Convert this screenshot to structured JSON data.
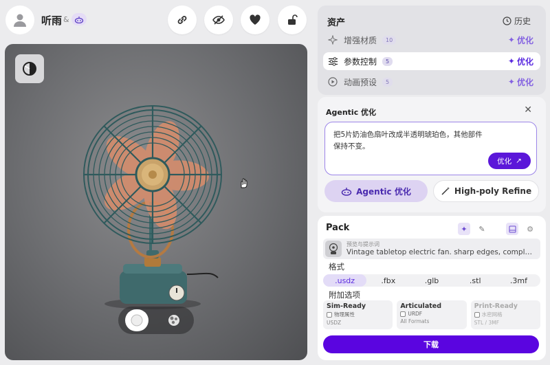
{
  "header": {
    "username": "听雨",
    "ampersand": "&",
    "agent_badge_icon": "agent-icon",
    "actions": [
      "link-icon",
      "eye-slash-icon",
      "heart-icon",
      "unlock-icon"
    ]
  },
  "viewport": {
    "toggle_icon": "half-circle-icon",
    "modes": [
      "solid-icon",
      "texture-icon"
    ],
    "cursor_icon": "hand-cursor-icon",
    "background_color": "#6d6e71"
  },
  "assets": {
    "title": "资产",
    "history_label": "历史",
    "rows": [
      {
        "label": "增强材质",
        "count": "10",
        "action": "优化",
        "icon": "sparkle-icon"
      },
      {
        "label": "参数控制",
        "count": "5",
        "action": "优化",
        "icon": "sliders-icon"
      },
      {
        "label": "动画预设",
        "count": "5",
        "action": "优化",
        "icon": "play-circle-icon"
      }
    ]
  },
  "agentic": {
    "title": "Agentic 优化",
    "prompt": "把5片奶油色扇叶改成半透明琥珀色，其他部件保持不变。",
    "submit_label": "优化",
    "tabs": [
      {
        "label": "Agentic 优化",
        "icon": "agent-icon"
      },
      {
        "label": "High-poly Refine",
        "icon": "magic-wand-icon"
      }
    ]
  },
  "pack": {
    "title": "Pack",
    "prompt_label": "预览与提示词",
    "prompt_text": "Vintage tabletop electric fan. sharp edges, complex...",
    "format_label": "格式",
    "formats": [
      ".usdz",
      ".fbx",
      ".glb",
      ".stl",
      ".3mf"
    ],
    "selected_format": ".usdz",
    "extras_label": "附加选项",
    "options": [
      {
        "title": "Sim-Ready",
        "check": "物理属性",
        "sub": "USDZ"
      },
      {
        "title": "Articulated",
        "check": "URDF",
        "sub": "All Formats"
      },
      {
        "title": "Print-Ready",
        "check": "水密网格",
        "sub": "STL / 3MF"
      }
    ],
    "download_label": "下载"
  },
  "colors": {
    "accent": "#5b17d9",
    "accent_light": "#e3dcf7",
    "panel": "#e2e2e6"
  }
}
